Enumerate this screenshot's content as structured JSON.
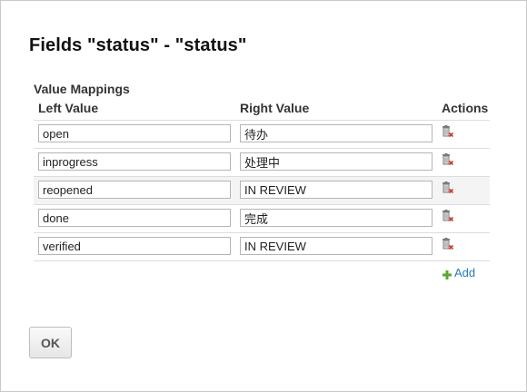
{
  "dialog": {
    "title": "Fields \"status\" - \"status\""
  },
  "mappings": {
    "section_title": "Value Mappings",
    "columns": {
      "left": "Left Value",
      "right": "Right Value",
      "actions": "Actions"
    },
    "rows": [
      {
        "left": "open",
        "right": "待办"
      },
      {
        "left": "inprogress",
        "right": "处理中"
      },
      {
        "left": "reopened",
        "right": "IN REVIEW"
      },
      {
        "left": "done",
        "right": "完成"
      },
      {
        "left": "verified",
        "right": "IN REVIEW"
      }
    ],
    "delete_icon": "trash-delete-icon",
    "add_label": "Add",
    "add_icon": "plus-icon"
  },
  "footer": {
    "ok_label": "OK"
  },
  "colors": {
    "link": "#2a7ab8",
    "add_icon": "#5aa832",
    "delete_mark": "#d9362b"
  }
}
